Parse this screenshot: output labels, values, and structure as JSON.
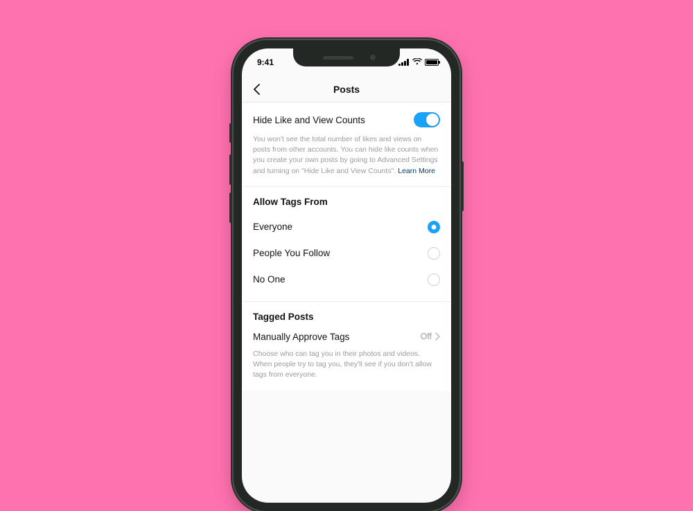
{
  "status": {
    "time": "9:41"
  },
  "nav": {
    "title": "Posts"
  },
  "hide_counts": {
    "label": "Hide Like and View Counts",
    "help": "You won't see the total number of likes and views on posts from other accounts. You can hide like counts when you create your own posts by going to Advanced Settings and turning on \"Hide Like and View Counts\".",
    "learn_more": "Learn More",
    "on": true
  },
  "allow_tags": {
    "title": "Allow Tags From",
    "options": [
      {
        "label": "Everyone",
        "selected": true
      },
      {
        "label": "People You Follow",
        "selected": false
      },
      {
        "label": "No One",
        "selected": false
      }
    ]
  },
  "tagged_posts": {
    "title": "Tagged Posts",
    "approve_label": "Manually Approve Tags",
    "approve_value": "Off",
    "help": "Choose who can tag you in their photos and videos. When people try to tag you, they'll see if you don't allow tags from everyone."
  }
}
